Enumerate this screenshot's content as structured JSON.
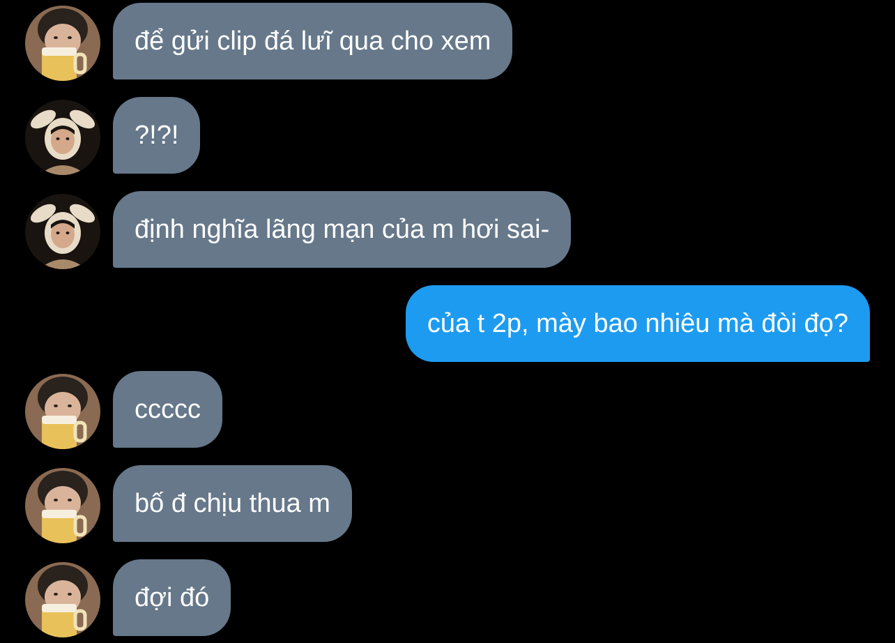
{
  "conversation": {
    "messages": [
      {
        "sender": "friend-beer",
        "avatar": "beer-glass-avatar",
        "text": "để gửi clip đá lưĩ qua cho xem"
      },
      {
        "sender": "friend-bunny",
        "avatar": "bunny-ears-avatar",
        "text": "?!?!"
      },
      {
        "sender": "friend-bunny",
        "avatar": "bunny-ears-avatar",
        "text": "định nghĩa lãng mạn của m hơi sai-"
      },
      {
        "sender": "me",
        "text": "của t 2p, mày bao nhiêu mà đòi đọ?"
      },
      {
        "sender": "friend-beer",
        "avatar": "beer-glass-avatar",
        "text": "ccccc"
      },
      {
        "sender": "friend-beer",
        "avatar": "beer-glass-avatar",
        "text": "bố đ chịu thua m"
      },
      {
        "sender": "friend-beer",
        "avatar": "beer-glass-avatar",
        "text": "đợi đó"
      }
    ]
  },
  "colors": {
    "background": "#000000",
    "incoming_bubble": "#66788a",
    "outgoing_bubble": "#1d9bf0",
    "text": "#ffffff"
  }
}
